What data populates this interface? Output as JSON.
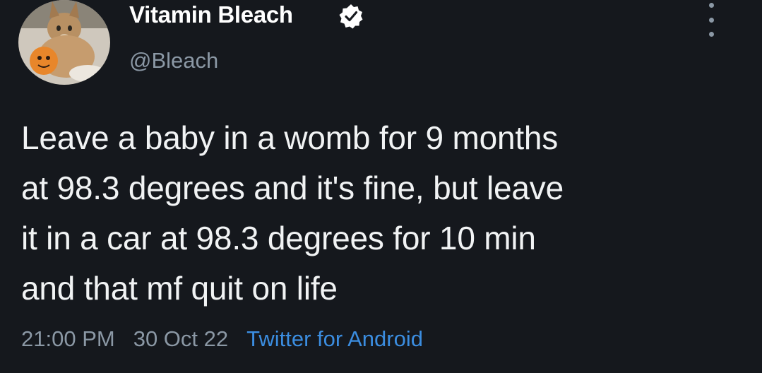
{
  "tweet": {
    "author": {
      "display_name": "Vitamin Bleach",
      "handle": "@Bleach",
      "verified": true,
      "avatar_icon": "cat-avatar-icon"
    },
    "text_lines": [
      "Leave a baby in a womb for 9 months",
      "at 98.3 degrees and it's fine, but leave",
      "it in a car at 98.3 degrees for 10 min",
      "and that mf quit on life"
    ],
    "time": "21:00 PM",
    "date": "30 Oct 22",
    "source": "Twitter for Android"
  },
  "colors": {
    "background": "#15181d",
    "text": "#f1f3f4",
    "muted": "#8b98a5",
    "link": "#3b8de0"
  }
}
